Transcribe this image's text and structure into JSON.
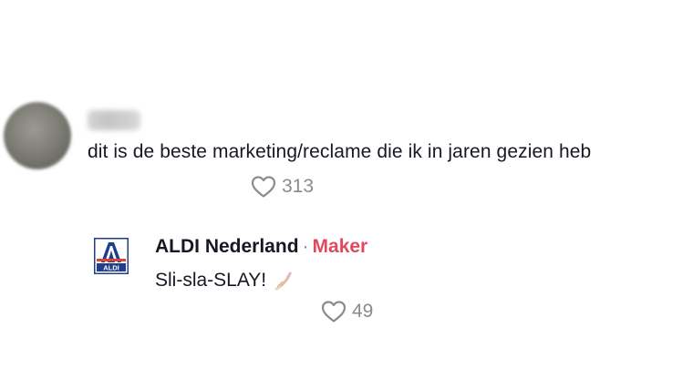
{
  "comment": {
    "text": "dit is de beste marketing/reclame die ik in jaren gezien heb",
    "likes": "313"
  },
  "reply": {
    "author": "ALDI Nederland",
    "separator": "·",
    "badge": "Maker",
    "text": "Sli-sla-SLAY!",
    "emoji_icon": "nail-polish-icon",
    "likes": "49",
    "logo": {
      "name": "aldi-logo",
      "brand_color": "#1f3e8c",
      "accent_color": "#e0432e"
    }
  },
  "colors": {
    "text": "#161823",
    "secondary": "#8a8b91",
    "maker_badge": "#e04a5f"
  }
}
